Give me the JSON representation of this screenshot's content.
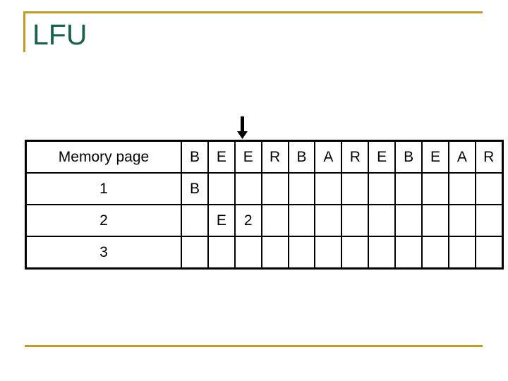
{
  "slide": {
    "title": "LFU",
    "title_color": "#19624a",
    "accent_color": "#bf9d22"
  },
  "pointer": {
    "icon": "down-arrow-icon",
    "points_at_column_index": 2,
    "color": "#000000"
  },
  "table": {
    "row_label_header": "Memory page",
    "reference_string": [
      "B",
      "E",
      "E",
      "R",
      "B",
      "A",
      "R",
      "E",
      "B",
      "E",
      "A",
      "R"
    ],
    "rows": [
      {
        "label": "1",
        "cells": [
          "B",
          "",
          "",
          "",
          "",
          "",
          "",
          "",
          "",
          "",
          "",
          ""
        ],
        "kinds": [
          "page",
          "",
          "",
          "",
          "",
          "",
          "",
          "",
          "",
          "",
          "",
          ""
        ]
      },
      {
        "label": "2",
        "cells": [
          "",
          "E",
          "2",
          "",
          "",
          "",
          "",
          "",
          "",
          "",
          "",
          ""
        ],
        "kinds": [
          "",
          "page",
          "count",
          "",
          "",
          "",
          "",
          "",
          "",
          "",
          "",
          ""
        ]
      },
      {
        "label": "3",
        "cells": [
          "",
          "",
          "",
          "",
          "",
          "",
          "",
          "",
          "",
          "",
          "",
          ""
        ],
        "kinds": [
          "",
          "",
          "",
          "",
          "",
          "",
          "",
          "",
          "",
          "",
          "",
          ""
        ]
      }
    ],
    "colors": {
      "page_value": "#cc99ee",
      "count_value": "#a02020",
      "border": "#000000"
    }
  }
}
